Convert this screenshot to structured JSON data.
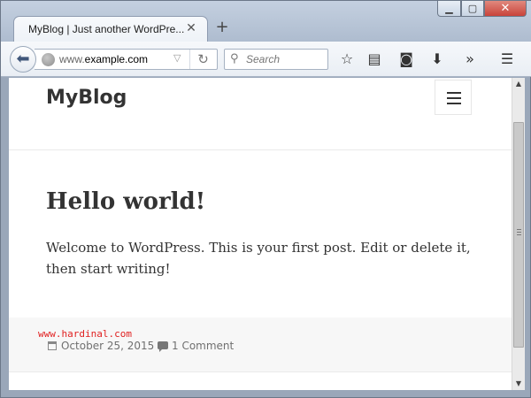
{
  "browser": {
    "tab_title": "MyBlog | Just another WordPre...",
    "tab_close": "✕",
    "new_tab": "+",
    "url_prefix": "www.",
    "url_domain": "example.com",
    "search_placeholder": "Search",
    "window_controls": {
      "minimize": "▁",
      "maximize": "▢",
      "close": "✕"
    }
  },
  "site": {
    "title": "MyBlog"
  },
  "post": {
    "title": "Hello world!",
    "body": "Welcome to WordPress. This is your first post. Edit or delete it, then start writing!",
    "date": "October 25, 2015",
    "comments": "1 Comment"
  },
  "watermark": "www.hardinal.com",
  "icons": {
    "back": "back-arrow-icon",
    "globe": "globe-icon",
    "reload": "reload-icon",
    "search": "search-icon",
    "bookmark": "star-icon",
    "reading_list": "clipboard-icon",
    "pocket": "pocket-icon",
    "downloads": "download-icon",
    "overflow": "chevron-double-right-icon",
    "menu": "hamburger-icon"
  }
}
